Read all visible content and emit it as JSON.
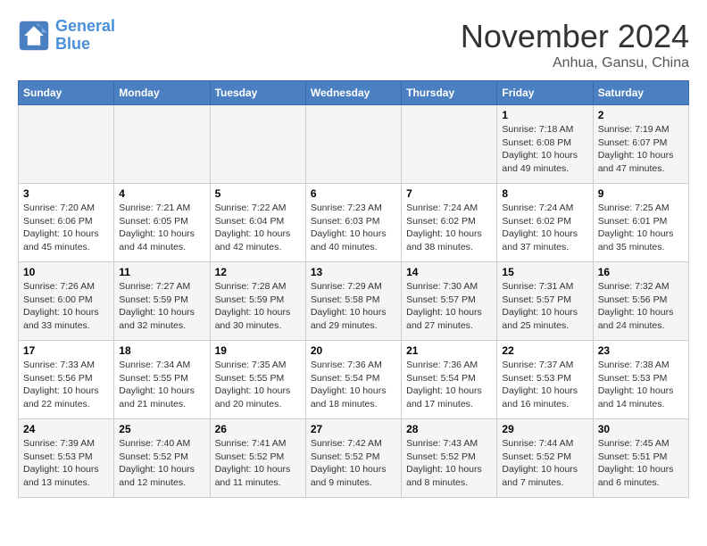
{
  "header": {
    "logo_line1": "General",
    "logo_line2": "Blue",
    "month_title": "November 2024",
    "subtitle": "Anhua, Gansu, China"
  },
  "weekdays": [
    "Sunday",
    "Monday",
    "Tuesday",
    "Wednesday",
    "Thursday",
    "Friday",
    "Saturday"
  ],
  "weeks": [
    [
      {
        "day": "",
        "info": ""
      },
      {
        "day": "",
        "info": ""
      },
      {
        "day": "",
        "info": ""
      },
      {
        "day": "",
        "info": ""
      },
      {
        "day": "",
        "info": ""
      },
      {
        "day": "1",
        "info": "Sunrise: 7:18 AM\nSunset: 6:08 PM\nDaylight: 10 hours\nand 49 minutes."
      },
      {
        "day": "2",
        "info": "Sunrise: 7:19 AM\nSunset: 6:07 PM\nDaylight: 10 hours\nand 47 minutes."
      }
    ],
    [
      {
        "day": "3",
        "info": "Sunrise: 7:20 AM\nSunset: 6:06 PM\nDaylight: 10 hours\nand 45 minutes."
      },
      {
        "day": "4",
        "info": "Sunrise: 7:21 AM\nSunset: 6:05 PM\nDaylight: 10 hours\nand 44 minutes."
      },
      {
        "day": "5",
        "info": "Sunrise: 7:22 AM\nSunset: 6:04 PM\nDaylight: 10 hours\nand 42 minutes."
      },
      {
        "day": "6",
        "info": "Sunrise: 7:23 AM\nSunset: 6:03 PM\nDaylight: 10 hours\nand 40 minutes."
      },
      {
        "day": "7",
        "info": "Sunrise: 7:24 AM\nSunset: 6:02 PM\nDaylight: 10 hours\nand 38 minutes."
      },
      {
        "day": "8",
        "info": "Sunrise: 7:24 AM\nSunset: 6:02 PM\nDaylight: 10 hours\nand 37 minutes."
      },
      {
        "day": "9",
        "info": "Sunrise: 7:25 AM\nSunset: 6:01 PM\nDaylight: 10 hours\nand 35 minutes."
      }
    ],
    [
      {
        "day": "10",
        "info": "Sunrise: 7:26 AM\nSunset: 6:00 PM\nDaylight: 10 hours\nand 33 minutes."
      },
      {
        "day": "11",
        "info": "Sunrise: 7:27 AM\nSunset: 5:59 PM\nDaylight: 10 hours\nand 32 minutes."
      },
      {
        "day": "12",
        "info": "Sunrise: 7:28 AM\nSunset: 5:59 PM\nDaylight: 10 hours\nand 30 minutes."
      },
      {
        "day": "13",
        "info": "Sunrise: 7:29 AM\nSunset: 5:58 PM\nDaylight: 10 hours\nand 29 minutes."
      },
      {
        "day": "14",
        "info": "Sunrise: 7:30 AM\nSunset: 5:57 PM\nDaylight: 10 hours\nand 27 minutes."
      },
      {
        "day": "15",
        "info": "Sunrise: 7:31 AM\nSunset: 5:57 PM\nDaylight: 10 hours\nand 25 minutes."
      },
      {
        "day": "16",
        "info": "Sunrise: 7:32 AM\nSunset: 5:56 PM\nDaylight: 10 hours\nand 24 minutes."
      }
    ],
    [
      {
        "day": "17",
        "info": "Sunrise: 7:33 AM\nSunset: 5:56 PM\nDaylight: 10 hours\nand 22 minutes."
      },
      {
        "day": "18",
        "info": "Sunrise: 7:34 AM\nSunset: 5:55 PM\nDaylight: 10 hours\nand 21 minutes."
      },
      {
        "day": "19",
        "info": "Sunrise: 7:35 AM\nSunset: 5:55 PM\nDaylight: 10 hours\nand 20 minutes."
      },
      {
        "day": "20",
        "info": "Sunrise: 7:36 AM\nSunset: 5:54 PM\nDaylight: 10 hours\nand 18 minutes."
      },
      {
        "day": "21",
        "info": "Sunrise: 7:36 AM\nSunset: 5:54 PM\nDaylight: 10 hours\nand 17 minutes."
      },
      {
        "day": "22",
        "info": "Sunrise: 7:37 AM\nSunset: 5:53 PM\nDaylight: 10 hours\nand 16 minutes."
      },
      {
        "day": "23",
        "info": "Sunrise: 7:38 AM\nSunset: 5:53 PM\nDaylight: 10 hours\nand 14 minutes."
      }
    ],
    [
      {
        "day": "24",
        "info": "Sunrise: 7:39 AM\nSunset: 5:53 PM\nDaylight: 10 hours\nand 13 minutes."
      },
      {
        "day": "25",
        "info": "Sunrise: 7:40 AM\nSunset: 5:52 PM\nDaylight: 10 hours\nand 12 minutes."
      },
      {
        "day": "26",
        "info": "Sunrise: 7:41 AM\nSunset: 5:52 PM\nDaylight: 10 hours\nand 11 minutes."
      },
      {
        "day": "27",
        "info": "Sunrise: 7:42 AM\nSunset: 5:52 PM\nDaylight: 10 hours\nand 9 minutes."
      },
      {
        "day": "28",
        "info": "Sunrise: 7:43 AM\nSunset: 5:52 PM\nDaylight: 10 hours\nand 8 minutes."
      },
      {
        "day": "29",
        "info": "Sunrise: 7:44 AM\nSunset: 5:52 PM\nDaylight: 10 hours\nand 7 minutes."
      },
      {
        "day": "30",
        "info": "Sunrise: 7:45 AM\nSunset: 5:51 PM\nDaylight: 10 hours\nand 6 minutes."
      }
    ]
  ]
}
